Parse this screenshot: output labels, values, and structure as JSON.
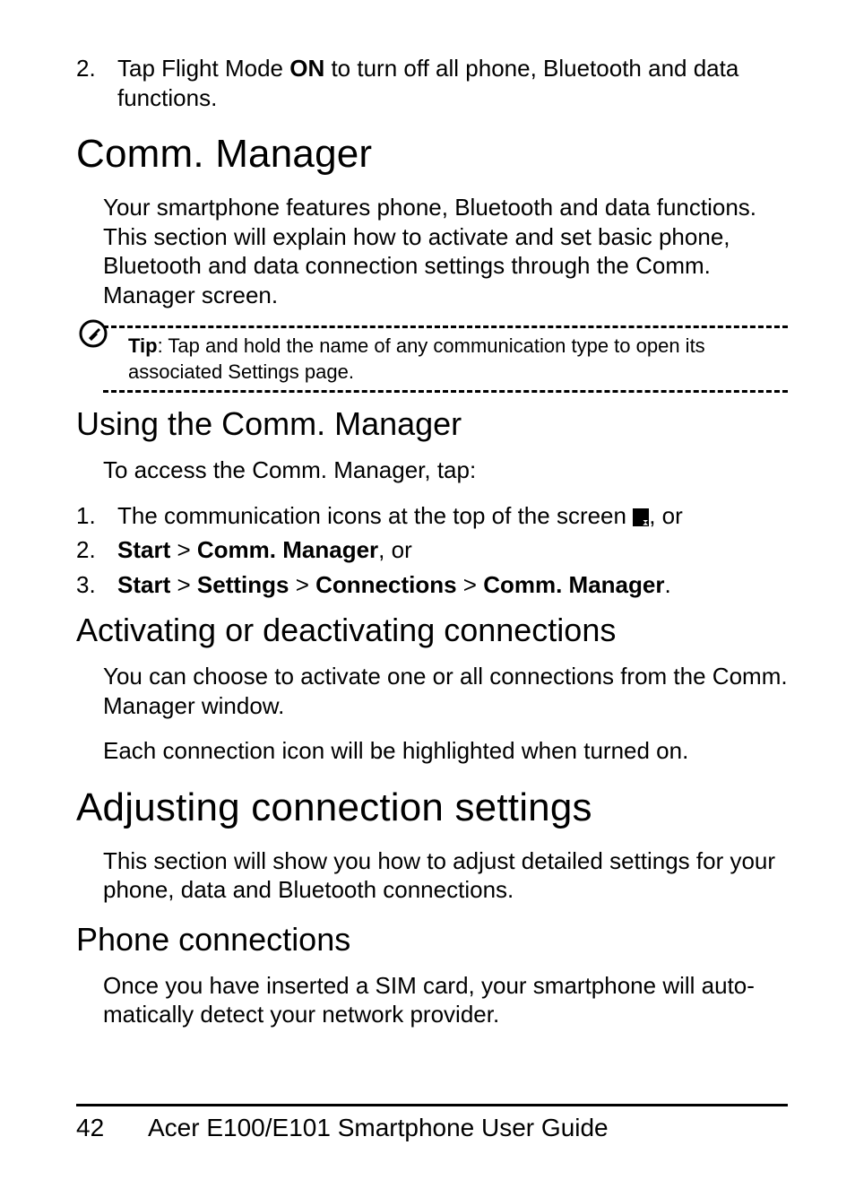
{
  "step2": {
    "num": "2.",
    "pre": "Tap Flight Mode ",
    "bold": "ON",
    "post": " to turn off all phone, Bluetooth and data functions."
  },
  "h1_comm": "Comm. Manager",
  "p_comm_intro": "Your smartphone features phone, Bluetooth and data func­tions. This section will explain how to activate and set basic phone, Bluetooth and data connection settings through the Comm. Manager screen.",
  "tip": {
    "label": "Tip",
    "text": ": Tap and hold the name of any communication type to open its associated Settings page."
  },
  "h2_using": "Using the Comm. Manager",
  "p_access": "To access the Comm. Manager, tap:",
  "list": {
    "i1": {
      "num": "1.",
      "pre": "The communication icons at the top of the screen ",
      "post": ", or"
    },
    "i2": {
      "num": "2.",
      "b1": "Start",
      "s1": " > ",
      "b2": "Comm. Manager",
      "post": ", or"
    },
    "i3": {
      "num": "3.",
      "b1": "Start",
      "s1": " > ",
      "b2": "Settings",
      "s2": " > ",
      "b3": "Connections",
      "s3": " > ",
      "b4": "Comm. Manager",
      "post": "."
    }
  },
  "h2_activate": "Activating or deactivating connections",
  "p_activate1": "You can choose to activate one or all connections from the Comm. Manager window.",
  "p_activate2": "Each connection icon will be highlighted when turned on.",
  "h1_adjust": "Adjusting connection settings",
  "p_adjust": "This section will show you how to adjust detailed settings for your phone, data and Bluetooth connections.",
  "h2_phone": "Phone connections",
  "p_phone": "Once you have inserted a SIM card, your smartphone will auto­matically detect your network provider.",
  "footer": {
    "page": "42",
    "title": "Acer E100/E101 Smartphone User Guide"
  }
}
